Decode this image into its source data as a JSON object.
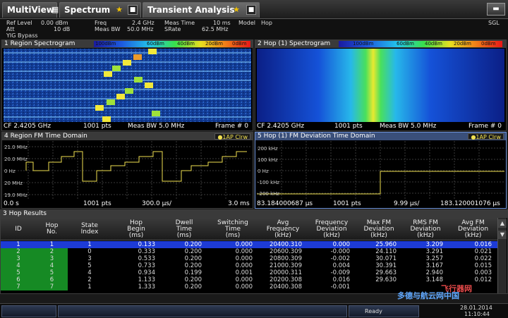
{
  "tabs": {
    "multiview": "MultiView",
    "spectrum": "Spectrum",
    "transient": "Transient Analysis"
  },
  "settings": {
    "ref_level_label": "Ref Level",
    "ref_level_value": "0.00 dBm",
    "att_label": "Att",
    "att_value": "10 dB",
    "yig": "YIG Bypass",
    "freq_label": "Freq",
    "freq_value": "2.4 GHz",
    "meas_bw_label": "Meas BW",
    "meas_bw_value": "50.0 MHz",
    "meas_time_label": "Meas Time",
    "meas_time_value": "10 ms",
    "srate_label": "SRate",
    "srate_value": "62.5 MHz",
    "model_label": "Model",
    "model_value": "Hop",
    "sgl": "SGL"
  },
  "pane1": {
    "title": "1 Region Spectrogram",
    "colorbar": [
      "100dBm",
      "60dBm",
      "40dBm",
      "20dBm",
      "0dBm"
    ],
    "cf": "CF 2.4205 GHz",
    "pts": "1001 pts",
    "bw": "Meas BW 5.0 MHz",
    "frame": "Frame # 0"
  },
  "pane2": {
    "title": "2 Hop (1) Spectrogram",
    "colorbar": [
      "100dBm",
      "60dBm",
      "40dBm",
      "20dBm",
      "0dBm"
    ],
    "cf": "CF 2.4205 GHz",
    "pts": "1001 pts",
    "bw": "Meas BW 5.0 MHz",
    "frame": "Frame # 0"
  },
  "pane4": {
    "title": "4 Region FM Time Domain",
    "trace": "●1AP Clrw",
    "yticks": [
      "21.0 MHz",
      "20.0 MHz",
      "0 Hz",
      "20 MHz",
      "19.0 MHz"
    ],
    "foot_left": "0.0 s",
    "foot_pts": "1001 pts",
    "foot_div": "300.0 µs/",
    "foot_right": "3.0 ms"
  },
  "pane5": {
    "title": "5 Hop (1) FM Deviation Time Domain",
    "trace": "●1AP Clrw",
    "yticks": [
      "200 kHz",
      "100 kHz",
      "0 Hz",
      "-100 kHz",
      "-200 kHz"
    ],
    "foot_left": "83.184000687 µs",
    "foot_pts": "1001 pts",
    "foot_div": "9.99 µs/",
    "foot_right": "183.120001076 µs"
  },
  "results": {
    "title": "3 Hop Results",
    "columns": [
      "ID",
      "Hop\nNo.",
      "State\nIndex",
      "Hop\nBegin\n(ms)",
      "Dwell\nTime\n(ms)",
      "Switching\nTime\n(ms)",
      "Avg\nFrequency\n(kHz)",
      "Frequency\nDeviation\n(kHz)",
      "Max FM\nDeviation\n(kHz)",
      "RMS FM\nDeviation\n(kHz)",
      "Avg FM\nDeviation\n(kHz)"
    ],
    "rows": [
      [
        "1",
        "1",
        "1",
        "0.133",
        "0.200",
        "0.000",
        "20400.310",
        "0.000",
        "25.960",
        "3.209",
        "0.016"
      ],
      [
        "2",
        "2",
        "0",
        "0.333",
        "0.200",
        "0.000",
        "20600.309",
        "-0.000",
        "24.110",
        "3.291",
        "0.021"
      ],
      [
        "3",
        "3",
        "3",
        "0.533",
        "0.200",
        "0.000",
        "20800.309",
        "-0.002",
        "30.071",
        "3.257",
        "0.022"
      ],
      [
        "4",
        "4",
        "5",
        "0.733",
        "0.200",
        "0.000",
        "21000.309",
        "0.004",
        "30.391",
        "3.167",
        "0.015"
      ],
      [
        "5",
        "5",
        "4",
        "0.934",
        "0.199",
        "0.001",
        "20000.311",
        "-0.009",
        "29.663",
        "2.940",
        "0.003"
      ],
      [
        "6",
        "6",
        "2",
        "1.133",
        "0.200",
        "0.000",
        "20200.308",
        "0.016",
        "29.630",
        "3.148",
        "0.012"
      ],
      [
        "7",
        "7",
        "1",
        "1.333",
        "0.200",
        "0.000",
        "20400.308",
        "-0.001",
        "",
        "",
        ""
      ]
    ]
  },
  "status": {
    "ready": "Ready",
    "date": "28.01.2014",
    "time": "11:10:44"
  },
  "watermark": {
    "line1": "多德与航云网中国",
    "line2": "飞行器网"
  }
}
